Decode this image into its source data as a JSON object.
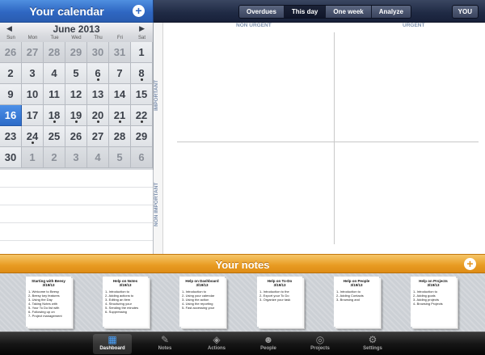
{
  "calendar": {
    "title": "Your calendar",
    "add_symbol": "+",
    "month": "June 2013",
    "prev_arrow": "◀",
    "next_arrow": "▶",
    "weekdays": [
      "Sun",
      "Mon",
      "Tue",
      "Wed",
      "Thu",
      "Fri",
      "Sat"
    ],
    "days": [
      {
        "n": "26",
        "other": true,
        "dot": false
      },
      {
        "n": "27",
        "other": true,
        "dot": false
      },
      {
        "n": "28",
        "other": true,
        "dot": false
      },
      {
        "n": "29",
        "other": true,
        "dot": false
      },
      {
        "n": "30",
        "other": true,
        "dot": false
      },
      {
        "n": "31",
        "other": true,
        "dot": false
      },
      {
        "n": "1",
        "other": false,
        "dot": false
      },
      {
        "n": "2",
        "other": false,
        "dot": false
      },
      {
        "n": "3",
        "other": false,
        "dot": false
      },
      {
        "n": "4",
        "other": false,
        "dot": false
      },
      {
        "n": "5",
        "other": false,
        "dot": false
      },
      {
        "n": "6",
        "other": false,
        "dot": true
      },
      {
        "n": "7",
        "other": false,
        "dot": false
      },
      {
        "n": "8",
        "other": false,
        "dot": true
      },
      {
        "n": "9",
        "other": false,
        "dot": false
      },
      {
        "n": "10",
        "other": false,
        "dot": false
      },
      {
        "n": "11",
        "other": false,
        "dot": false
      },
      {
        "n": "12",
        "other": false,
        "dot": false
      },
      {
        "n": "13",
        "other": false,
        "dot": false
      },
      {
        "n": "14",
        "other": false,
        "dot": false
      },
      {
        "n": "15",
        "other": false,
        "dot": false
      },
      {
        "n": "16",
        "other": false,
        "dot": false,
        "today": true
      },
      {
        "n": "17",
        "other": false,
        "dot": false
      },
      {
        "n": "18",
        "other": false,
        "dot": true
      },
      {
        "n": "19",
        "other": false,
        "dot": true
      },
      {
        "n": "20",
        "other": false,
        "dot": true
      },
      {
        "n": "21",
        "other": false,
        "dot": true
      },
      {
        "n": "22",
        "other": false,
        "dot": true
      },
      {
        "n": "23",
        "other": false,
        "dot": false
      },
      {
        "n": "24",
        "other": false,
        "dot": true
      },
      {
        "n": "25",
        "other": false,
        "dot": false
      },
      {
        "n": "26",
        "other": false,
        "dot": false
      },
      {
        "n": "27",
        "other": false,
        "dot": false
      },
      {
        "n": "28",
        "other": false,
        "dot": false
      },
      {
        "n": "29",
        "other": false,
        "dot": false
      },
      {
        "n": "30",
        "other": false,
        "dot": false
      },
      {
        "n": "1",
        "other": true,
        "dot": false
      },
      {
        "n": "2",
        "other": true,
        "dot": false
      },
      {
        "n": "3",
        "other": true,
        "dot": false
      },
      {
        "n": "4",
        "other": true,
        "dot": false
      },
      {
        "n": "5",
        "other": true,
        "dot": false
      },
      {
        "n": "6",
        "other": true,
        "dot": false
      }
    ]
  },
  "topbar": {
    "segments": [
      {
        "label": "Overdues",
        "active": false
      },
      {
        "label": "This day",
        "active": true
      },
      {
        "label": "One week",
        "active": false
      },
      {
        "label": "Analyze",
        "active": false
      }
    ],
    "user_button": "YOU"
  },
  "matrix": {
    "col_non_urgent": "NON URGENT",
    "col_urgent": "URGENT",
    "row_important": "IMPORTANT",
    "row_non_important": "NON IMPORTANT"
  },
  "notes": {
    "title": "Your notes",
    "add_symbol": "+",
    "items": [
      {
        "title": "Starting with Beesy",
        "date": "3/19/13",
        "lines": [
          "1- Welcome to Beesy",
          "2- Beesy key features",
          "3- Using the Day",
          "4- Taking Notes with",
          "5- Your To Do list with",
          "6- Following up on",
          "7- Project management"
        ]
      },
      {
        "title": "Help on Notes",
        "date": "3/19/13",
        "lines": [
          "1- Introduction to",
          "2- Adding actions to",
          "3- Editing an item",
          "4- Structuring your",
          "5- Sending the minutes",
          "6- Suppressing"
        ]
      },
      {
        "title": "Help on Dashboard",
        "date": "3/19/13",
        "lines": [
          "1- Introduction to",
          "2- Using your calendar",
          "3- Using the action",
          "4- Using the reporting",
          "5- Fast accessing your"
        ]
      },
      {
        "title": "Help on To-Do",
        "date": "3/19/13",
        "lines": [
          "1- Introduction to the",
          "2- Export your To Do",
          "3- Organize your task"
        ]
      },
      {
        "title": "Help on People",
        "date": "3/19/13",
        "lines": [
          "1- Introduction to",
          "2- Adding Contacts",
          "3- Browsing and"
        ]
      },
      {
        "title": "Help on Projects",
        "date": "3/19/13",
        "lines": [
          "1- Introduction to",
          "2- Adding goals",
          "3- Adding projects",
          "4- Browsing Projects"
        ]
      }
    ]
  },
  "tabbar": {
    "tabs": [
      {
        "key": "dashboard",
        "label": "Dashboard",
        "icon": "▦",
        "icon_name": "dashboard-icon",
        "active": true
      },
      {
        "key": "notes",
        "label": "Notes",
        "icon": "✎",
        "icon_name": "notes-icon",
        "active": false
      },
      {
        "key": "actions",
        "label": "Actions",
        "icon": "◈",
        "icon_name": "actions-icon",
        "active": false
      },
      {
        "key": "people",
        "label": "People",
        "icon": "☻",
        "icon_name": "people-icon",
        "active": false
      },
      {
        "key": "projects",
        "label": "Projects",
        "icon": "◎",
        "icon_name": "projects-icon",
        "active": false
      },
      {
        "key": "settings",
        "label": "Settings",
        "icon": "⚙",
        "icon_name": "settings-icon",
        "active": false
      }
    ]
  },
  "colors": {
    "calendar_header": "#2f67c2",
    "top_bar": "#1f2a44",
    "notes_header": "#e89b22",
    "today": "#2c6bc8"
  }
}
